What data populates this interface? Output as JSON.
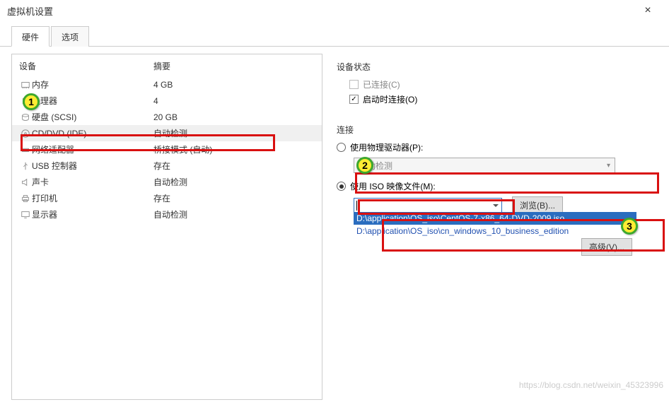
{
  "window": {
    "title": "虚拟机设置",
    "close": "×"
  },
  "tabs": {
    "hardware": "硬件",
    "options": "选项"
  },
  "device_table": {
    "col_device": "设备",
    "col_summary": "摘要",
    "rows": [
      {
        "name": "内存",
        "summary": "4 GB"
      },
      {
        "name": "处理器",
        "summary": "4"
      },
      {
        "name": "硬盘 (SCSI)",
        "summary": "20 GB"
      },
      {
        "name": "CD/DVD (IDE)",
        "summary": "自动检测"
      },
      {
        "name": "网络适配器",
        "summary": "桥接模式 (自动)"
      },
      {
        "name": "USB 控制器",
        "summary": "存在"
      },
      {
        "name": "声卡",
        "summary": "自动检测"
      },
      {
        "name": "打印机",
        "summary": "存在"
      },
      {
        "name": "显示器",
        "summary": "自动检测"
      }
    ]
  },
  "status": {
    "group": "设备状态",
    "connected": "已连接(C)",
    "connect_on_start": "启动时连接(O)"
  },
  "connection": {
    "group": "连接",
    "use_physical": "使用物理驱动器(P):",
    "physical_value": "自动检测",
    "use_iso": "使用 ISO 映像文件(M):",
    "browse": "浏览(B)...",
    "advanced": "高级(V)...",
    "dropdown": [
      "D:\\application\\OS_iso\\CentOS-7-x86_64-DVD-2009.iso",
      "D:\\application\\OS_iso\\cn_windows_10_business_edition"
    ]
  },
  "badges": {
    "b1": "1",
    "b2": "2",
    "b3": "3"
  },
  "watermark": "https://blog.csdn.net/weixin_45323996"
}
